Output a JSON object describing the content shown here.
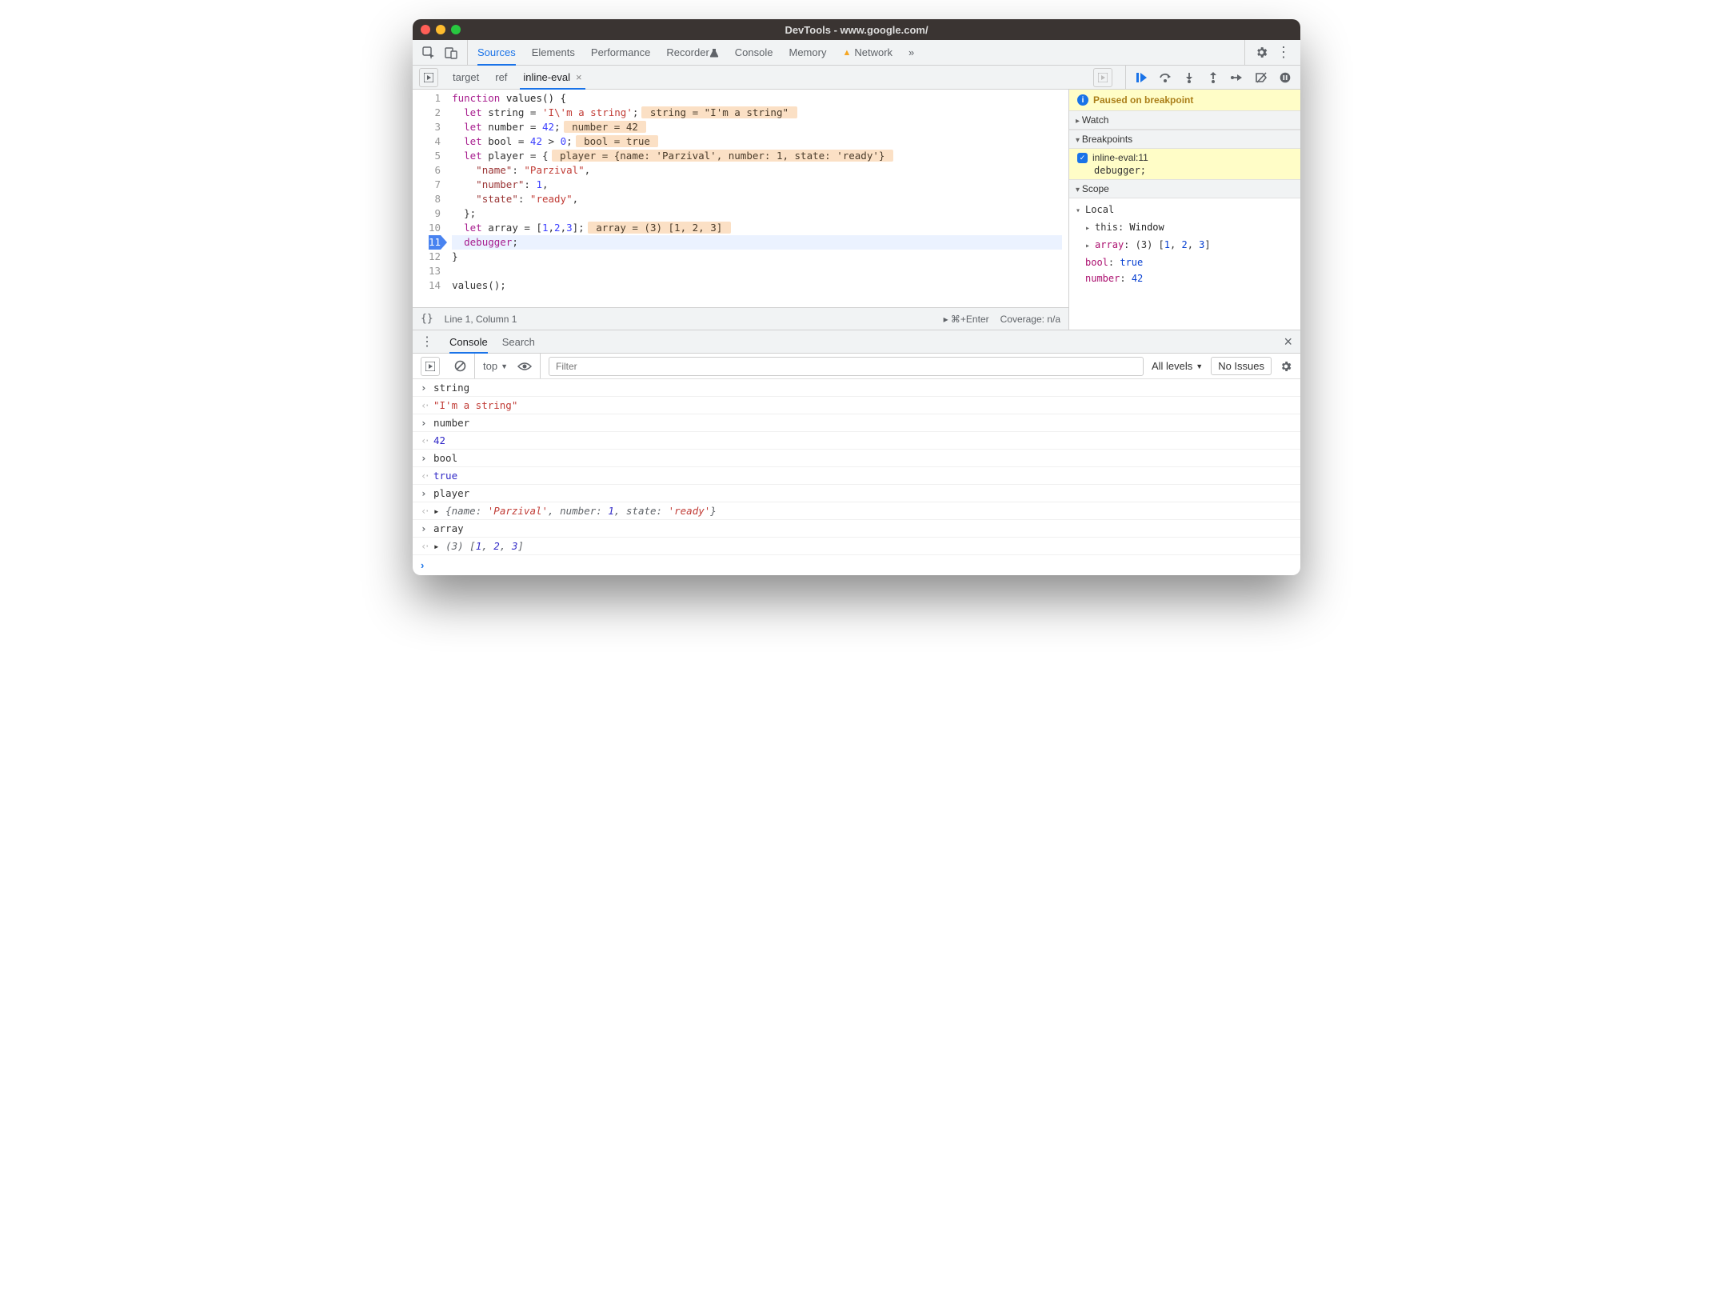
{
  "window": {
    "title": "DevTools - www.google.com/"
  },
  "panels": {
    "tabs": [
      "Sources",
      "Elements",
      "Performance",
      "Recorder",
      "Console",
      "Memory",
      "Network"
    ],
    "active": "Sources",
    "recorder_flask": "🧪",
    "warn_tab": "Network",
    "overflow": "»"
  },
  "file_tabs": {
    "items": [
      "target",
      "ref",
      "inline-eval"
    ],
    "active": "inline-eval"
  },
  "debugger_buttons": [
    "resume",
    "step-over",
    "step-into",
    "step-out",
    "step",
    "deactivate",
    "pause-exceptions"
  ],
  "code": {
    "lines": [
      {
        "n": 1,
        "segs": [
          {
            "t": "function",
            "c": "kw"
          },
          {
            "t": " "
          },
          {
            "t": "values",
            "c": "fn"
          },
          {
            "t": "() {",
            "c": "punct"
          }
        ]
      },
      {
        "n": 2,
        "segs": [
          {
            "t": "  "
          },
          {
            "t": "let",
            "c": "kw"
          },
          {
            "t": " string = "
          },
          {
            "t": "'I\\'m a string'",
            "c": "str"
          },
          {
            "t": ";"
          }
        ],
        "eval": "string = \"I'm a string\""
      },
      {
        "n": 3,
        "segs": [
          {
            "t": "  "
          },
          {
            "t": "let",
            "c": "kw"
          },
          {
            "t": " number = "
          },
          {
            "t": "42",
            "c": "num"
          },
          {
            "t": ";"
          }
        ],
        "eval": "number = 42"
      },
      {
        "n": 4,
        "segs": [
          {
            "t": "  "
          },
          {
            "t": "let",
            "c": "kw"
          },
          {
            "t": " bool = "
          },
          {
            "t": "42",
            "c": "num"
          },
          {
            "t": " > "
          },
          {
            "t": "0",
            "c": "num"
          },
          {
            "t": ";"
          }
        ],
        "eval": "bool = true"
      },
      {
        "n": 5,
        "segs": [
          {
            "t": "  "
          },
          {
            "t": "let",
            "c": "kw"
          },
          {
            "t": " player = {"
          }
        ],
        "eval": "player = {name: 'Parzival', number: 1, state: 'ready'}"
      },
      {
        "n": 6,
        "segs": [
          {
            "t": "    "
          },
          {
            "t": "\"name\"",
            "c": "strkey"
          },
          {
            "t": ": "
          },
          {
            "t": "\"Parzival\"",
            "c": "str"
          },
          {
            "t": ","
          }
        ]
      },
      {
        "n": 7,
        "segs": [
          {
            "t": "    "
          },
          {
            "t": "\"number\"",
            "c": "strkey"
          },
          {
            "t": ": "
          },
          {
            "t": "1",
            "c": "num"
          },
          {
            "t": ","
          }
        ]
      },
      {
        "n": 8,
        "segs": [
          {
            "t": "    "
          },
          {
            "t": "\"state\"",
            "c": "strkey"
          },
          {
            "t": ": "
          },
          {
            "t": "\"ready\"",
            "c": "str"
          },
          {
            "t": ","
          }
        ]
      },
      {
        "n": 9,
        "segs": [
          {
            "t": "  };"
          }
        ]
      },
      {
        "n": 10,
        "segs": [
          {
            "t": "  "
          },
          {
            "t": "let",
            "c": "kw"
          },
          {
            "t": " array = ["
          },
          {
            "t": "1",
            "c": "num"
          },
          {
            "t": ","
          },
          {
            "t": "2",
            "c": "num"
          },
          {
            "t": ","
          },
          {
            "t": "3",
            "c": "num"
          },
          {
            "t": "];"
          }
        ],
        "eval": "array = (3) [1, 2, 3]"
      },
      {
        "n": 11,
        "hl": true,
        "bp": true,
        "segs": [
          {
            "t": "  "
          },
          {
            "t": "debugger",
            "c": "dbg"
          },
          {
            "t": ";"
          }
        ]
      },
      {
        "n": 12,
        "segs": [
          {
            "t": "}"
          }
        ]
      },
      {
        "n": 13,
        "segs": [
          {
            "t": ""
          }
        ]
      },
      {
        "n": 14,
        "segs": [
          {
            "t": "values();"
          }
        ]
      }
    ]
  },
  "status": {
    "braces": "{}",
    "pos": "Line 1, Column 1",
    "run": "▸ ⌘+Enter",
    "coverage": "Coverage: n/a"
  },
  "sidebar": {
    "paused": "Paused on breakpoint",
    "sections": {
      "watch": "Watch",
      "breakpoints": "Breakpoints",
      "scope": "Scope"
    },
    "bp_item": {
      "label": "inline-eval:11",
      "sub": "debugger;"
    },
    "scope_label": "Local",
    "scope_rows": [
      {
        "tri": true,
        "html": "this: <span class='objlit'>Window</span>"
      },
      {
        "tri": true,
        "html": "<span class='prop'>array</span>: (3) <span class='arr'>[<span class='valnum'>1</span>, <span class='valnum'>2</span>, <span class='valnum'>3</span>]</span>"
      },
      {
        "html": "<span class='prop'>bool</span>: <span class='valkw'>true</span>"
      },
      {
        "html": "<span class='prop'>number</span>: <span class='valnum'>42</span>"
      }
    ]
  },
  "console": {
    "tabs": [
      "Console",
      "Search"
    ],
    "active": "Console",
    "context": "top",
    "filter_placeholder": "Filter",
    "levels": "All levels",
    "issues": "No Issues",
    "rows": [
      {
        "dir": "in",
        "text": "string"
      },
      {
        "dir": "out",
        "html": "<span class='str'>\"I'm a string\"</span>"
      },
      {
        "dir": "in",
        "text": "number"
      },
      {
        "dir": "out",
        "html": "<span class='num'>42</span>"
      },
      {
        "dir": "in",
        "text": "bool"
      },
      {
        "dir": "out",
        "html": "<span class='bool'>true</span>"
      },
      {
        "dir": "in",
        "text": "player"
      },
      {
        "dir": "out",
        "html": "▸ <span class='obj'>{<span class='k'>name</span>: <span class='v'>'Parzival'</span>, <span class='k'>number</span>: <span class='vn'>1</span>, <span class='k'>state</span>: <span class='v'>'ready'</span>}</span>"
      },
      {
        "dir": "in",
        "text": "array"
      },
      {
        "dir": "out",
        "html": "▸ <span class='arr'>(3) [<span class='n'>1</span>, <span class='n'>2</span>, <span class='n'>3</span>]</span>"
      }
    ]
  }
}
